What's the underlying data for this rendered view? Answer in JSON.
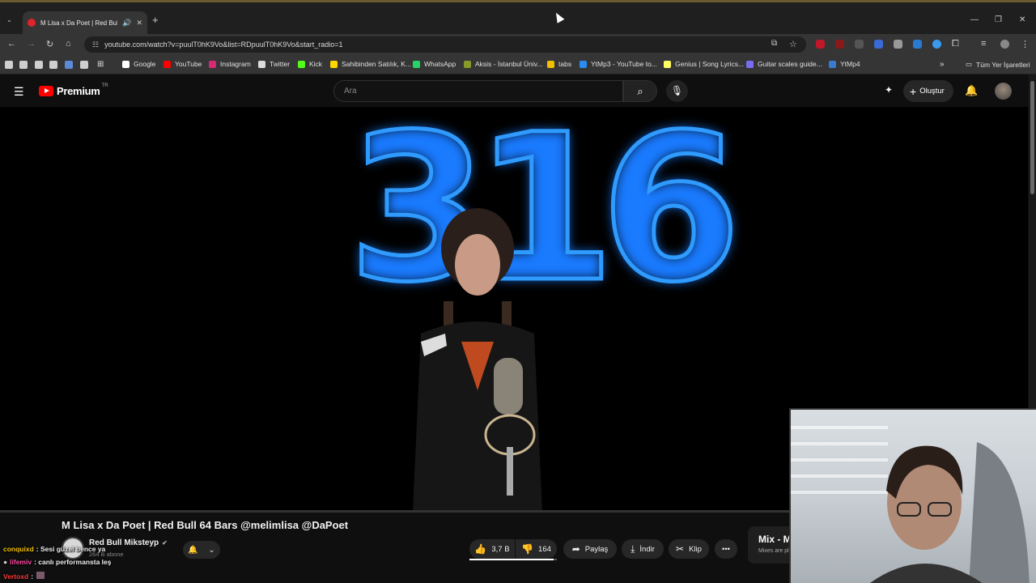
{
  "browser": {
    "tab_title": "M Lisa x Da Poet | Red Bull",
    "url": "youtube.com/watch?v=puulT0hK9Vo&list=RDpuulT0hK9Vo&start_radio=1",
    "bookmarks": [
      {
        "label": "Google",
        "color": "#ffffff"
      },
      {
        "label": "YouTube",
        "color": "#ff0000"
      },
      {
        "label": "Instagram",
        "color": "#d62976"
      },
      {
        "label": "Twitter",
        "color": "#dddddd"
      },
      {
        "label": "Kick",
        "color": "#53fc18"
      },
      {
        "label": "Sahibinden Satılık, K...",
        "color": "#ffd500"
      },
      {
        "label": "WhatsApp",
        "color": "#25d366"
      },
      {
        "label": "Aksis - İstanbul Üniv...",
        "color": "#8a9a2a"
      },
      {
        "label": "tabs",
        "color": "#f0c000"
      },
      {
        "label": "YtMp3 - YouTube to...",
        "color": "#2a8cf0"
      },
      {
        "label": "Genius | Song Lyrics...",
        "color": "#ffff64"
      },
      {
        "label": "Guitar scales guide...",
        "color": "#7a6cf0"
      },
      {
        "label": "YtMp4",
        "color": "#3a7ad0"
      }
    ],
    "all_bookmarks": "Tüm Yer İşaretleri"
  },
  "youtube": {
    "logo": "Premium",
    "country": "TR",
    "search_placeholder": "Ara",
    "create_label": "Oluştur"
  },
  "video": {
    "title": "M Lisa x Da Poet | Red Bull 64 Bars @melimlisa @DaPoet",
    "neon_text": "316",
    "channel": "Red Bull Mikstеyp",
    "subscribers": "264 B abone",
    "likes": "3,7 B",
    "dislikes": "164",
    "share": "Paylaş",
    "download": "İndir",
    "clip": "Klip",
    "like_ratio": 0.96,
    "mix_title": "Mix - M",
    "mix_sub": "Mixes are pl"
  },
  "chat": [
    {
      "user": "conquixd",
      "text": ": Sesi güzel bence ya",
      "color": "#f5c400"
    },
    {
      "user": "lifemiv",
      "text": ": canlı performansta leş",
      "color": "#ff4da6"
    },
    {
      "user": "Vertoxd",
      "text": ":",
      "color": "#ff3b3b"
    }
  ]
}
